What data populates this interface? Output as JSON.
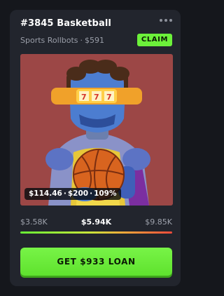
{
  "card": {
    "title": "#3845 Basketball",
    "collection": "Sports Rollbots",
    "separator": "·",
    "floor_price": "$591",
    "claim_label": "CLAIM",
    "more_icon": "more-horizontal-icon"
  },
  "artwork": {
    "background_color": "#9c4746",
    "price_label": {
      "value": "$114.46",
      "separator1": "·",
      "cost": "$200",
      "separator2": "·",
      "percent": "109%"
    }
  },
  "range": {
    "low": "$3.58K",
    "mid": "$5.94K",
    "high": "$9.85K"
  },
  "loan_button_label": "GET $933 LOAN",
  "colors": {
    "accent_green": "#6cf13a",
    "card_bg": "#22252d",
    "page_bg": "#15171c"
  }
}
